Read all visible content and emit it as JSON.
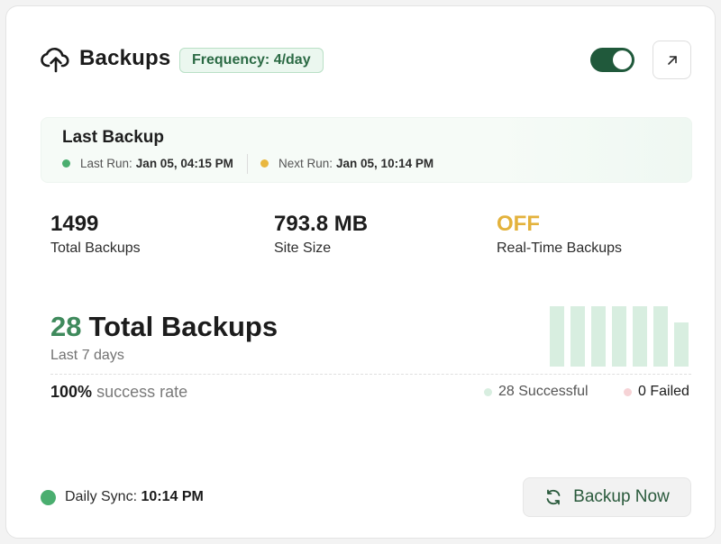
{
  "header": {
    "title": "Backups",
    "frequency_badge": "Frequency: 4/day",
    "toggle_on": true,
    "icons": {
      "upload": "cloud-upload-icon",
      "external": "arrow-up-right-icon"
    }
  },
  "last_backup": {
    "title": "Last Backup",
    "last_run_label": "Last Run:",
    "last_run_value": "Jan 05, 04:15 PM",
    "next_run_label": "Next Run:",
    "next_run_value": "Jan 05, 10:14 PM"
  },
  "stats": [
    {
      "value": "1499",
      "label": "Total Backups"
    },
    {
      "value": "793.8 MB",
      "label": "Site Size"
    },
    {
      "value": "OFF",
      "label": "Real-Time Backups"
    }
  ],
  "summary": {
    "count": "28",
    "title": "Total Backups",
    "period": "Last 7 days",
    "rate_value": "100%",
    "rate_label": "success rate",
    "successful": "28 Successful",
    "failed": "0 Failed",
    "daily_counts": [
      4,
      4,
      4,
      4,
      4,
      4,
      3
    ]
  },
  "footer": {
    "sync_label": "Daily Sync:",
    "sync_time": "10:14 PM",
    "backup_button": "Backup Now"
  },
  "colors": {
    "accent": "#20593b",
    "success": "#3f8a5c",
    "warning": "#e3b23c",
    "bar": "#d8eee0",
    "failed_dot": "#f6d3d6"
  }
}
